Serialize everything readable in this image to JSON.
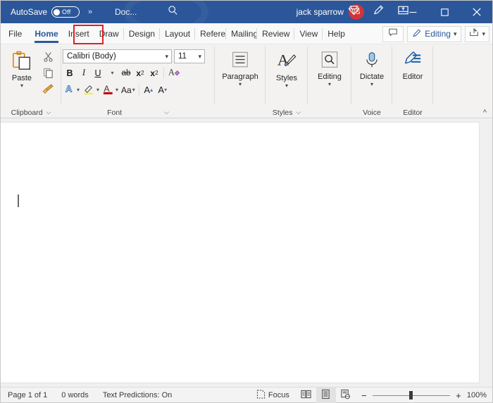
{
  "titlebar": {
    "autosave_label": "AutoSave",
    "autosave_state": "Off",
    "overflow_chevron": "»",
    "doc_name": "Doc...",
    "search_icon": "search-icon",
    "user_name": "jack sparrow",
    "user_initials": "JS",
    "avatar_color": "#d13438",
    "background_color": "#2b579a",
    "icons": [
      "diamond-icon",
      "pen-draw-icon",
      "restore-ribbon-icon"
    ],
    "window_buttons": [
      "minimize",
      "maximize",
      "close"
    ]
  },
  "tabs": {
    "items": [
      {
        "label": "File",
        "active": false
      },
      {
        "label": "Home",
        "active": true
      },
      {
        "label": "Insert",
        "active": false
      },
      {
        "label": "Draw",
        "active": false
      },
      {
        "label": "Design",
        "active": false
      },
      {
        "label": "Layout",
        "active": false
      },
      {
        "label": "Refere",
        "active": false
      },
      {
        "label": "Mailing",
        "active": false
      },
      {
        "label": "Review",
        "active": false
      },
      {
        "label": "View",
        "active": false
      },
      {
        "label": "Help",
        "active": false
      }
    ],
    "highlight_tab": "Insert",
    "highlight_color": "#e02020",
    "active_color": "#2b579a",
    "comments_icon": "comment-icon",
    "editing_label": "Editing",
    "editing_icon": "pencil-icon",
    "share_icon": "share-icon"
  },
  "ribbon": {
    "clipboard": {
      "group_label": "Clipboard",
      "paste_label": "Paste",
      "cut_icon": "scissors-icon",
      "copy_icon": "copy-icon",
      "format_painter_icon": "format-painter-icon",
      "dialog_launcher": "dialog-launcher-icon"
    },
    "font": {
      "group_label": "Font",
      "font_name": "Calibri (Body)",
      "font_size": "11",
      "bold": "B",
      "italic": "I",
      "underline": "U",
      "strikethrough": "ab",
      "subscript": "x",
      "superscript": "x",
      "clear_formatting_icon": "clear-formatting-icon",
      "text_effects_icon": "text-effects-icon",
      "highlight_icon": "text-highlight-icon",
      "font_color_icon": "font-color-icon",
      "change_case": "Aa",
      "grow_font": "A",
      "shrink_font": "A",
      "dialog_launcher": "dialog-launcher-icon"
    },
    "paragraph": {
      "group_label": "",
      "button_label": "Paragraph",
      "icon": "paragraph-lines-icon"
    },
    "styles": {
      "group_label": "Styles",
      "button_label": "Styles",
      "icon": "styles-brush-icon",
      "dialog_launcher": "dialog-launcher-icon"
    },
    "editing": {
      "group_label": "",
      "button_label": "Editing",
      "icon": "magnifier-icon"
    },
    "voice": {
      "group_label": "Voice",
      "button_label": "Dictate",
      "icon": "microphone-icon"
    },
    "editor": {
      "group_label": "Editor",
      "button_label": "Editor",
      "icon": "editor-pen-icon"
    },
    "collapse_icon": "chevron-up-icon"
  },
  "document": {
    "caret_visible": true,
    "page_background": "#ffffff"
  },
  "statusbar": {
    "page_info": "Page 1 of 1",
    "word_count": "0 words",
    "text_predictions": "Text Predictions: On",
    "focus_label": "Focus",
    "focus_icon": "focus-icon",
    "view_read_icon": "read-mode-icon",
    "view_print_icon": "print-layout-icon",
    "view_web_icon": "web-layout-icon",
    "selected_view": "print-layout",
    "zoom_out": "−",
    "zoom_in": "+",
    "zoom_level": "100%"
  }
}
